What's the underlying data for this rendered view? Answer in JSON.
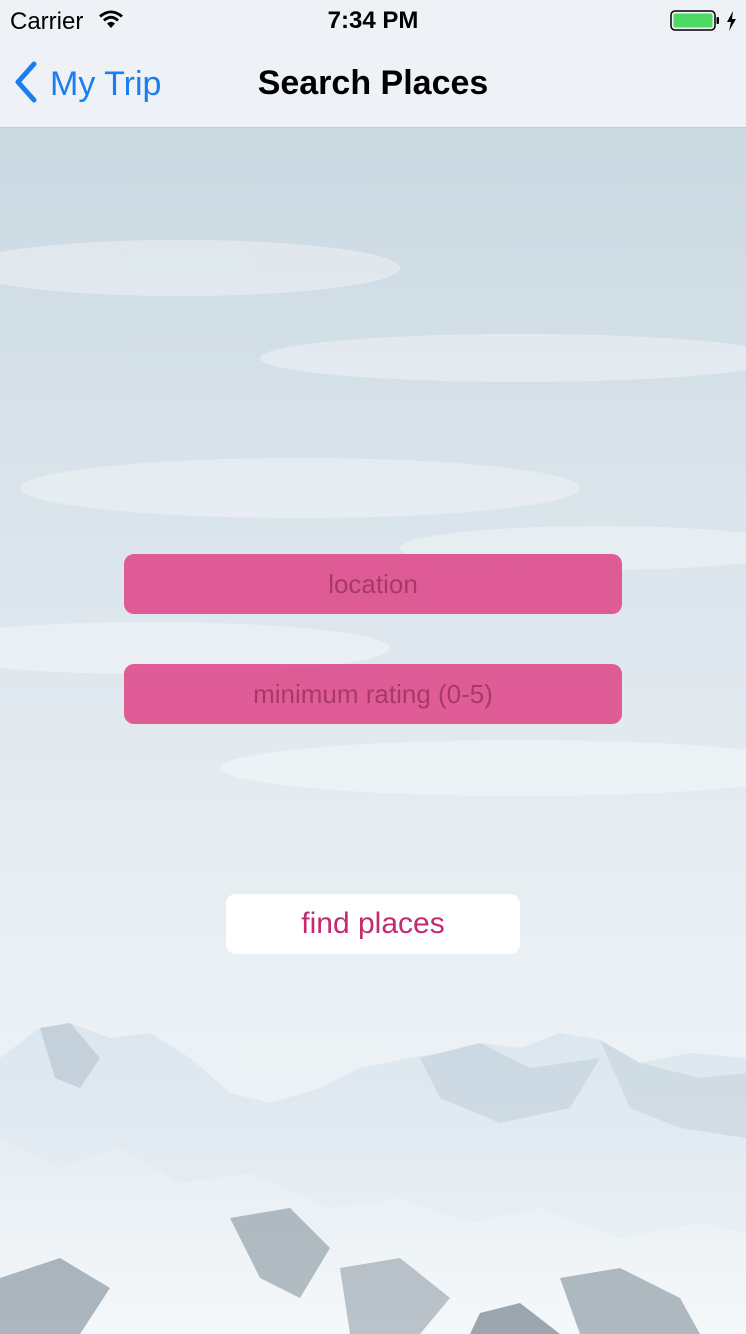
{
  "status_bar": {
    "carrier": "Carrier",
    "time": "7:34 PM",
    "icons": [
      "wifi-icon",
      "battery-icon",
      "charging-bolt-icon"
    ],
    "battery_color": "#4cd964"
  },
  "nav_bar": {
    "back_label": "My Trip",
    "back_icon": "chevron-left-icon",
    "title": "Search Places",
    "accent_color": "#1a7ef0"
  },
  "form": {
    "location": {
      "placeholder": "location",
      "value": ""
    },
    "min_rating": {
      "placeholder": "minimum rating (0-5)",
      "value": ""
    },
    "field_color": "#de488a",
    "submit_label": "find places",
    "submit_text_color": "#c42a6f"
  },
  "background": {
    "description_icon": "snowy-mountains-background"
  }
}
